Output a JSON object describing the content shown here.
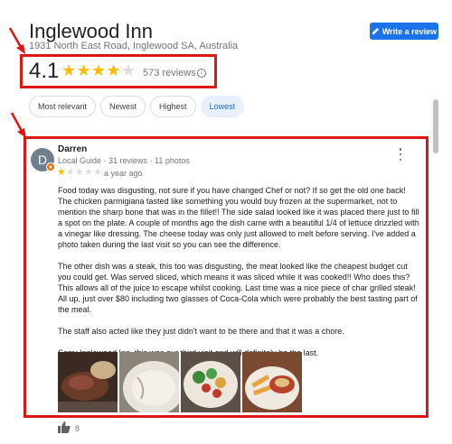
{
  "place": {
    "name": "Inglewood Inn",
    "address": "1931 North East Road, Inglewood SA, Australia"
  },
  "write_review_label": "Write a review",
  "rating": {
    "value": "4.1",
    "stars_filled": 4,
    "stars_total": 5,
    "count_label": "573 reviews"
  },
  "filters": [
    {
      "label": "Most relevant",
      "active": false
    },
    {
      "label": "Newest",
      "active": false
    },
    {
      "label": "Highest",
      "active": false
    },
    {
      "label": "Lowest",
      "active": true
    }
  ],
  "review": {
    "avatar_letter": "D",
    "author": "Darren",
    "meta": "Local Guide · 31 reviews · 11 photos",
    "stars_filled": 1,
    "stars_total": 5,
    "date": "a year ago",
    "paragraphs": [
      "Food today was disgusting, not sure if you have changed Chef or not?  If so get the old one back!  The chicken parmigiana tasted like something you would buy frozen at the supermarket, not to mention the sharp bone that was in the  fillet!!  The side salad looked like it was placed there just to fill a spot on the plate.  A couple of months ago the dish came with a beautiful 1/4 of lettuce drizzled with a vinegar like dressing.  The cheese today was only just allowed to melt before serving.  I've added a photo taken during the last visit so you can see the difference.",
      "The other dish was a steak, this too was disgusting, the meat looked like the cheapest budget cut you could get.  Was served sliced, which means it was sliced while it was cooked!! Who does this?  This allows all of the juice to escape whilst cooking.  Last time was a nice piece of char grilled steak!  All up, just over $80 including two glasses of Coca-Cola which were probably the best tasting part of the meal.",
      "The staff also acted like they just didn't want to be there and that it was a chore.",
      "Sorry Inglewood Inn, this was our third visit and will definitely be the last."
    ],
    "like_count": "8"
  },
  "colors": {
    "star_filled": "#fbbc04",
    "star_empty": "#dadce0",
    "highlight": "#e01616",
    "accent": "#1a73e8"
  }
}
